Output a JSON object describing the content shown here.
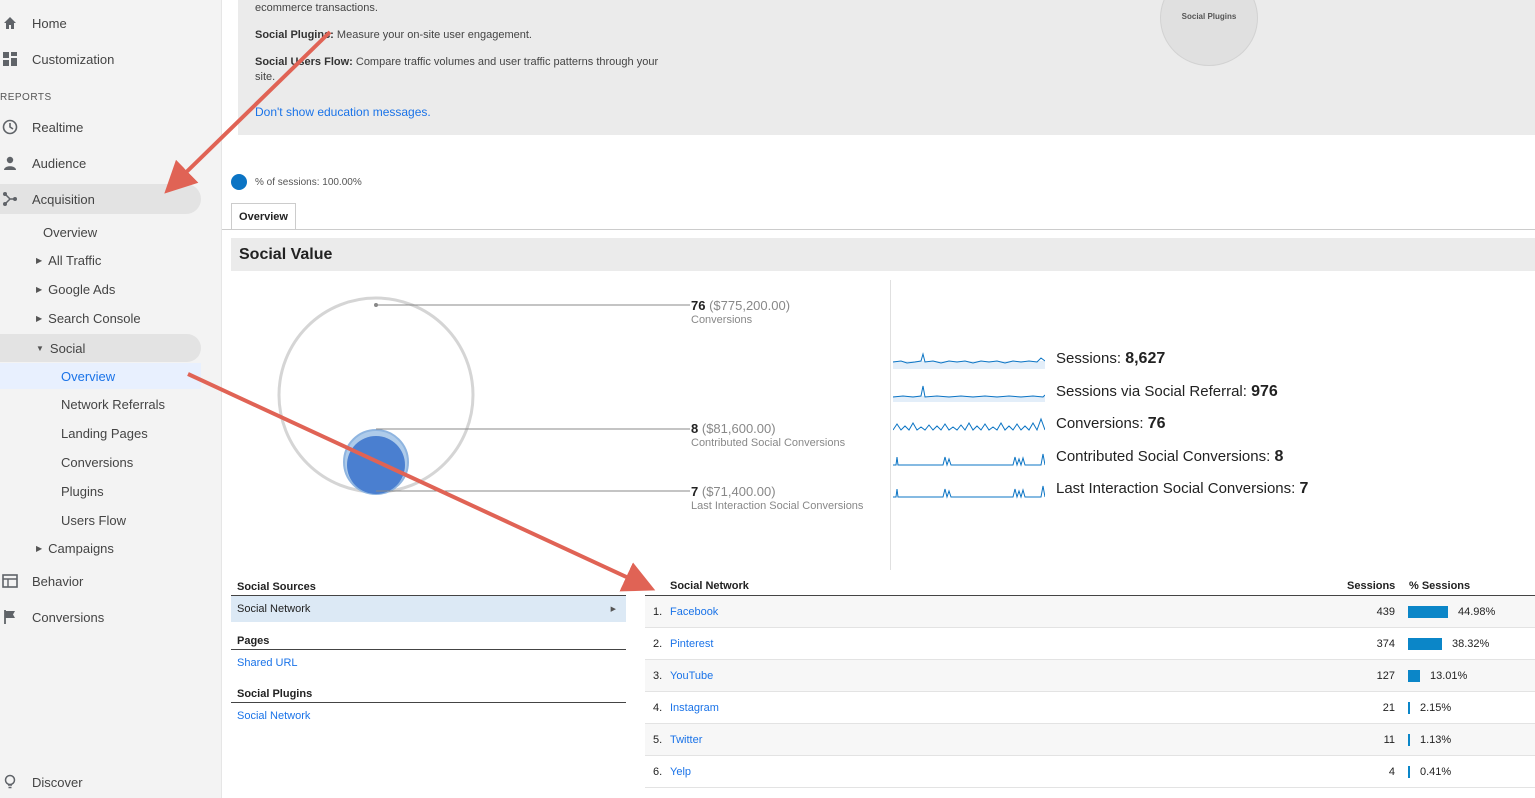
{
  "sidebar": {
    "home": "Home",
    "customization": "Customization",
    "reports_label": "REPORTS",
    "realtime": "Realtime",
    "audience": "Audience",
    "acquisition": "Acquisition",
    "overview": "Overview",
    "all_traffic": "All Traffic",
    "google_ads": "Google Ads",
    "search_console": "Search Console",
    "social": "Social",
    "social_items": [
      "Overview",
      "Network Referrals",
      "Landing Pages",
      "Conversions",
      "Plugins",
      "Users Flow"
    ],
    "campaigns": "Campaigns",
    "behavior": "Behavior",
    "conversions": "Conversions",
    "discover": "Discover"
  },
  "banner": {
    "line0": "ecommerce transactions.",
    "plugins_bold": "Social Plugins:",
    "plugins_text": " Measure your on-site user engagement.",
    "flow_bold": "Social Users Flow:",
    "flow_text": " Compare traffic volumes and user traffic patterns through your",
    "flow_text2": "site.",
    "dont_show": "Don't show education messages.",
    "bubble_label": "Social Plugins"
  },
  "legend": {
    "text": "% of sessions: 100.00%"
  },
  "tabs": {
    "overview": "Overview"
  },
  "section": {
    "title": "Social Value"
  },
  "metrics": {
    "conversions": {
      "num": "76",
      "money": "($775,200.00)",
      "label": "Conversions"
    },
    "contributed": {
      "num": "8",
      "money": "($81,600.00)",
      "label": "Contributed Social Conversions"
    },
    "last": {
      "num": "7",
      "money": "($71,400.00)",
      "label": "Last Interaction Social Conversions"
    }
  },
  "sparks": [
    {
      "label": "Sessions: ",
      "value": "8,627"
    },
    {
      "label": "Sessions via Social Referral: ",
      "value": "976"
    },
    {
      "label": "Conversions: ",
      "value": "76"
    },
    {
      "label": "Contributed Social Conversions: ",
      "value": "8"
    },
    {
      "label": "Last Interaction Social Conversions: ",
      "value": "7"
    }
  ],
  "left_table": {
    "social_sources": "Social Sources",
    "social_network": "Social Network",
    "pages": "Pages",
    "shared_url": "Shared URL",
    "social_plugins": "Social Plugins",
    "social_network2": "Social Network"
  },
  "right_table": {
    "col_network": "Social Network",
    "col_sessions": "Sessions",
    "col_pct": "% Sessions",
    "rows": [
      {
        "idx": "1.",
        "name": "Facebook",
        "sessions": "439",
        "pct": "44.98%",
        "frac": 0.4498
      },
      {
        "idx": "2.",
        "name": "Pinterest",
        "sessions": "374",
        "pct": "38.32%",
        "frac": 0.3832
      },
      {
        "idx": "3.",
        "name": "YouTube",
        "sessions": "127",
        "pct": "13.01%",
        "frac": 0.1301
      },
      {
        "idx": "4.",
        "name": "Instagram",
        "sessions": "21",
        "pct": "2.15%",
        "frac": 0.0215
      },
      {
        "idx": "5.",
        "name": "Twitter",
        "sessions": "11",
        "pct": "1.13%",
        "frac": 0.0113
      },
      {
        "idx": "6.",
        "name": "Yelp",
        "sessions": "4",
        "pct": "0.41%",
        "frac": 0.0041
      }
    ]
  },
  "colors": {
    "accent": "#1a73e8",
    "bar": "#0b86c8",
    "arrow": "#e06355"
  }
}
